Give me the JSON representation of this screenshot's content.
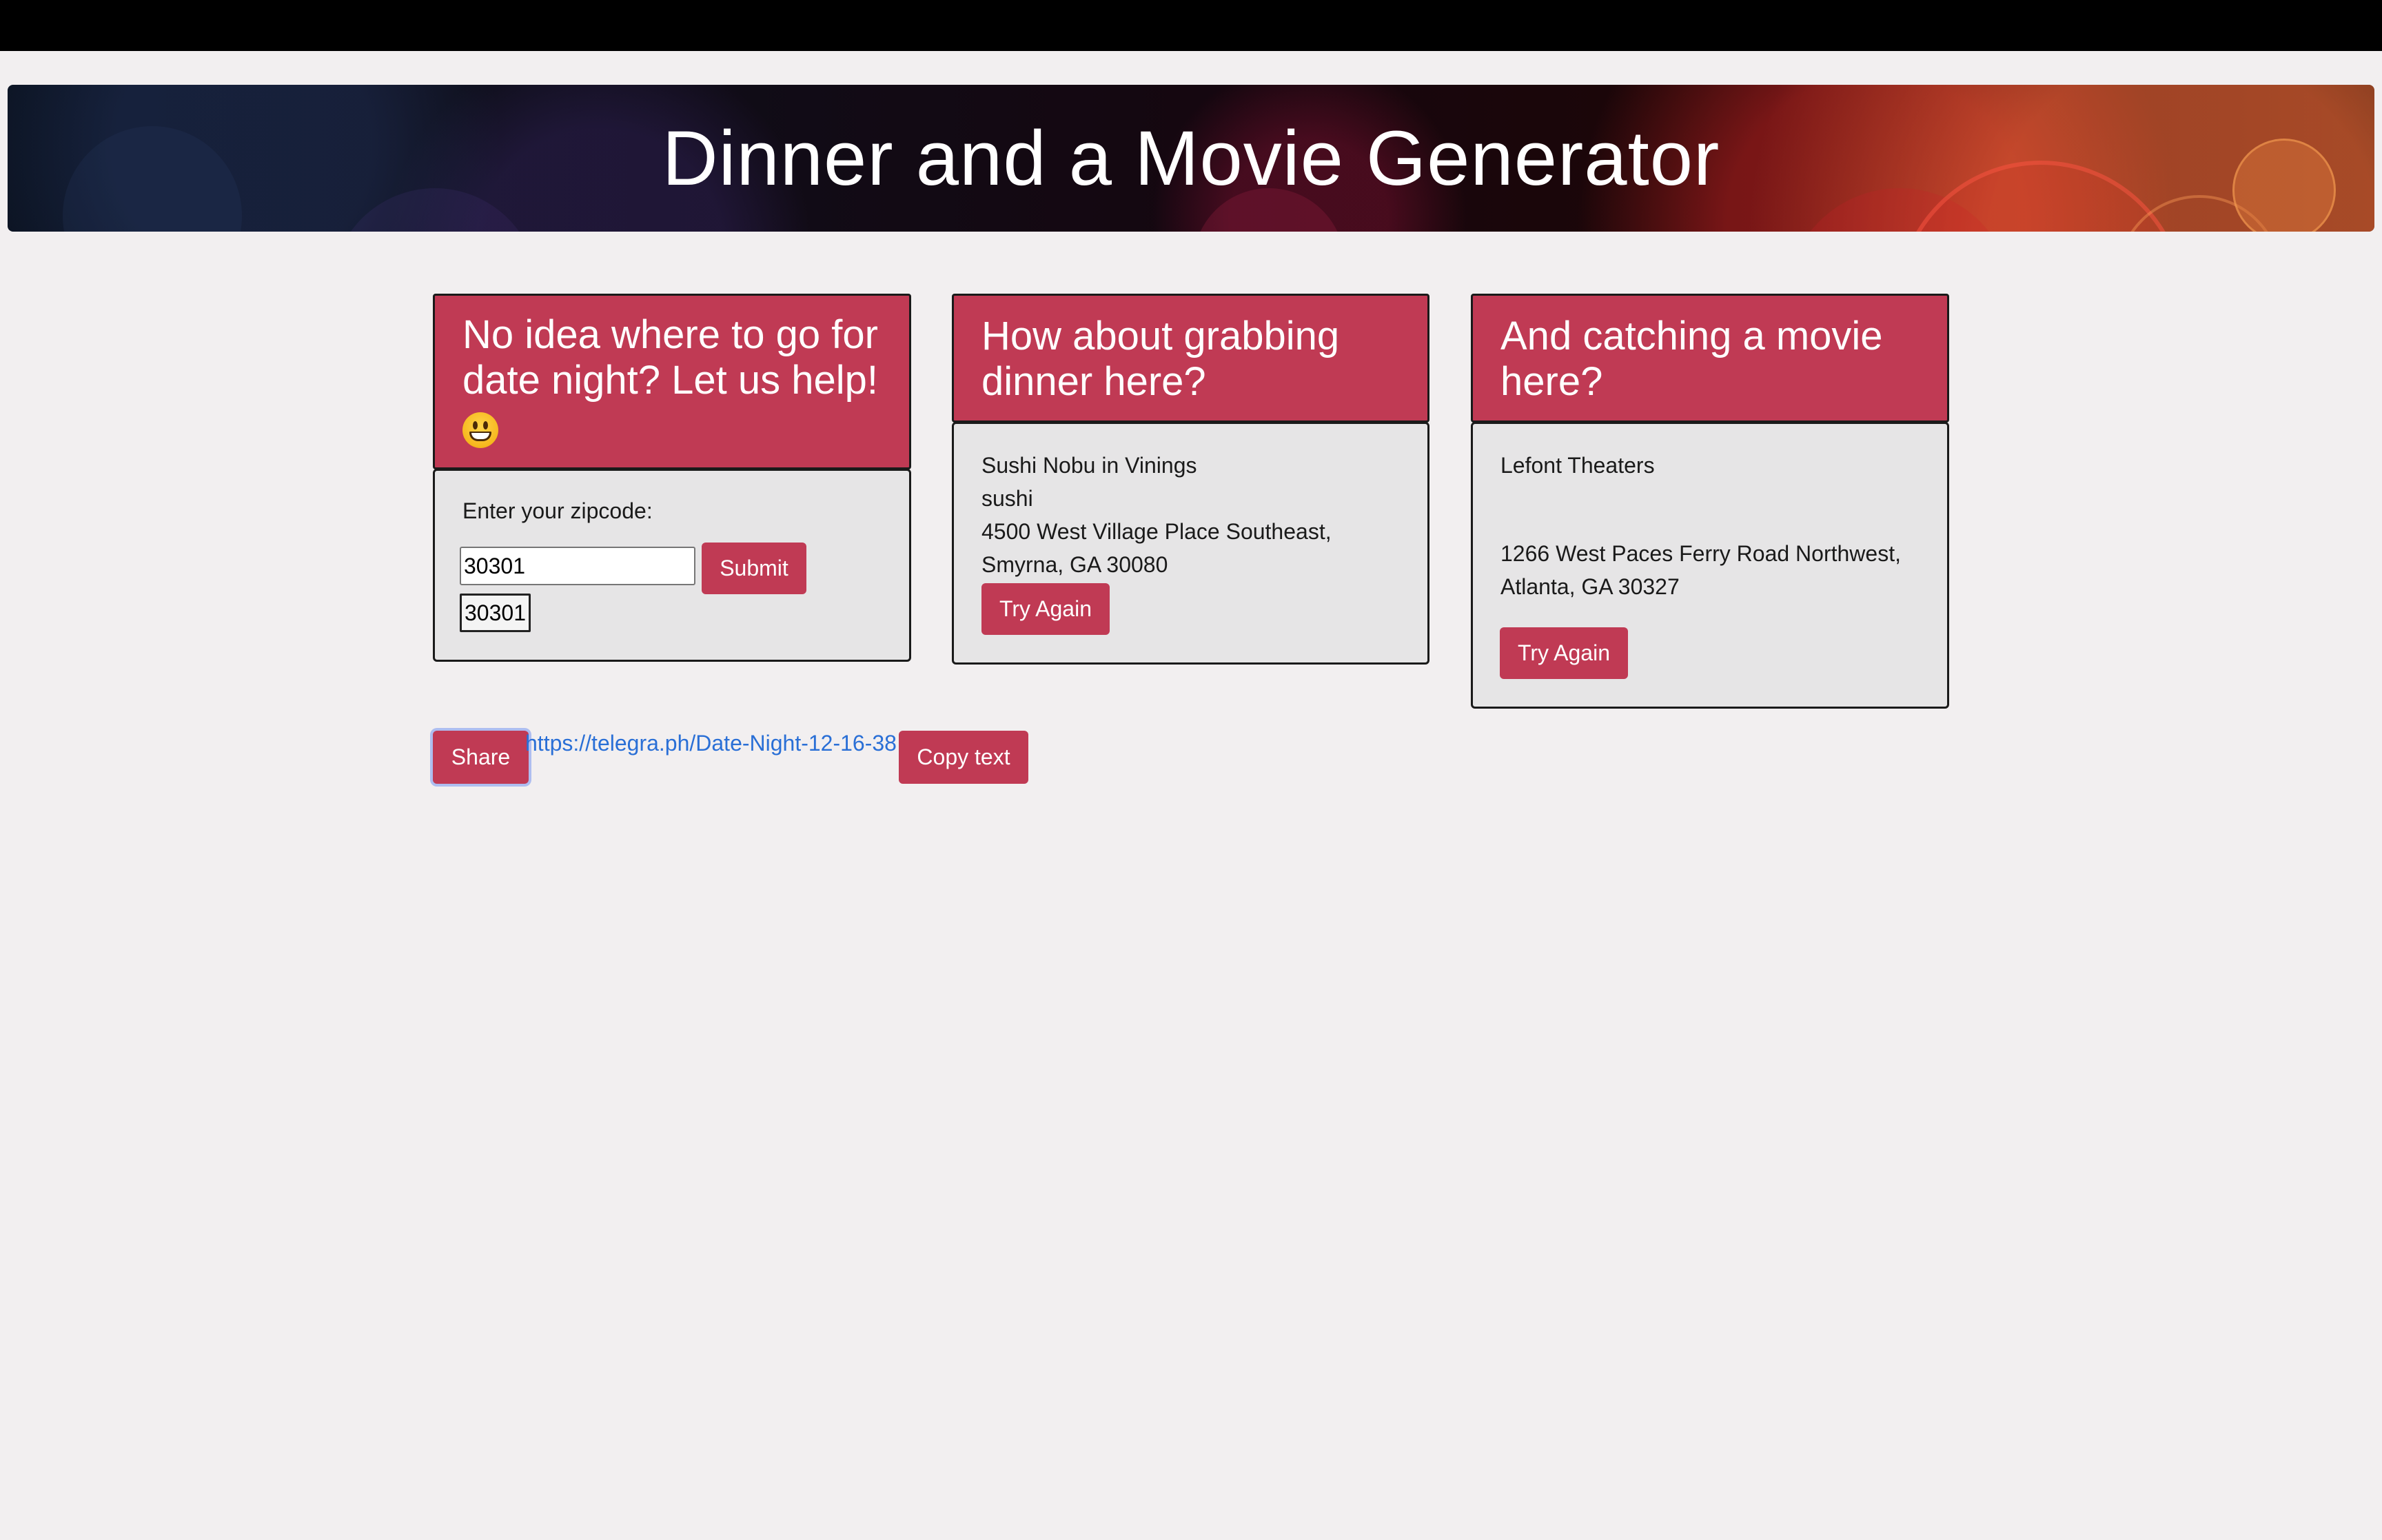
{
  "banner": {
    "title": "Dinner and a Movie Generator"
  },
  "search_card": {
    "heading": "No idea where to go for date night? Let us help!",
    "heading_emoji": "grinning-face-emoji",
    "zip_label": "Enter your zipcode:",
    "zip_value": "30301",
    "submit_label": "Submit",
    "zip_echo": "30301"
  },
  "dinner_card": {
    "heading": "How about grabbing dinner here?",
    "name": "Sushi Nobu in Vinings",
    "cuisine": "sushi",
    "address_line1": "4500 West Village Place Southeast,",
    "address_line2": "Smyrna, GA 30080",
    "try_again_label": "Try Again"
  },
  "movie_card": {
    "heading": "And catching a movie here?",
    "name": "Lefont Theaters",
    "address_line1": "1266 West Paces Ferry Road Northwest,",
    "address_line2": "Atlanta, GA 30327",
    "try_again_label": "Try Again"
  },
  "share": {
    "share_label": "Share",
    "link_text": "https://telegra.ph/Date-Night-12-16-38",
    "copy_label": "Copy text"
  },
  "colors": {
    "accent": "#c03a54",
    "background": "#f2eff0",
    "card_body": "#e6e5e6",
    "link": "#2a6fd6"
  }
}
